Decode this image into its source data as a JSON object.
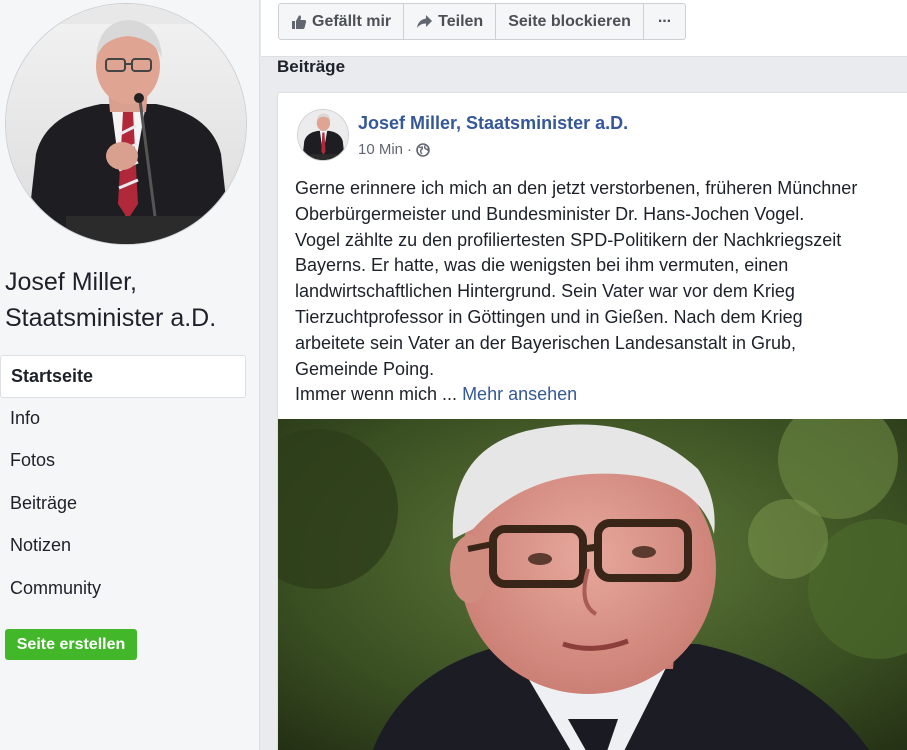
{
  "page": {
    "name_line1": "Josef Miller,",
    "name_line2": "Staatsminister a.D."
  },
  "nav": {
    "items": [
      {
        "label": "Startseite",
        "active": true
      },
      {
        "label": "Info"
      },
      {
        "label": "Fotos"
      },
      {
        "label": "Beiträge"
      },
      {
        "label": "Notizen"
      },
      {
        "label": "Community"
      }
    ],
    "create_label": "Seite erstellen"
  },
  "actions": {
    "like_label": "Gefällt mir",
    "share_label": "Teilen",
    "block_label": "Seite blockieren",
    "more_label": "···"
  },
  "section_title": "Beiträge",
  "post": {
    "author": "Josef Miller, Staatsminister a.D.",
    "time": "10 Min",
    "separator": "·",
    "privacy_icon": "globe-icon",
    "lines": [
      "Gerne erinnere ich mich an den jetzt verstorbenen, früheren Münchner",
      "Oberbürgermeister und Bundesminister Dr. Hans-Jochen Vogel.",
      "Vogel zählte zu den profiliertesten SPD-Politikern der Nachkriegszeit",
      "Bayerns. Er hatte, was die wenigsten bei ihm vermuten, einen",
      "landwirtschaftlichen Hintergrund. Sein Vater war vor dem Krieg",
      "Tierzuchtprofessor in Göttingen und in Gießen. Nach dem Krieg",
      "arbeitete sein Vater an der Bayerischen Landesanstalt in Grub,",
      "Gemeinde Poing."
    ],
    "last_line": "Immer wenn mich ...",
    "more_link": "Mehr ansehen"
  },
  "colors": {
    "link": "#365899",
    "create_button": "#42b72a",
    "background": "#e9ebee"
  }
}
